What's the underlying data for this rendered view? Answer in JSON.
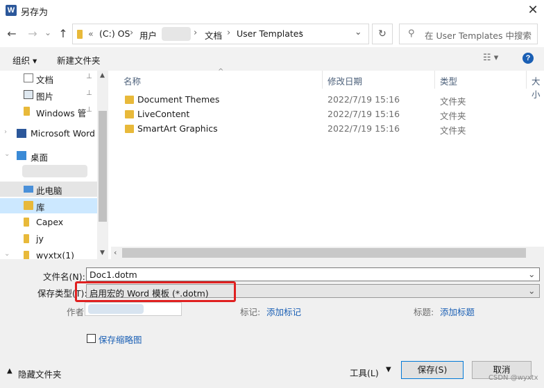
{
  "window": {
    "title": "另存为",
    "app_icon": "W",
    "close": "✕"
  },
  "nav": {
    "back": "←",
    "forward": "→",
    "dropdown": "⌄",
    "up": "↑",
    "refresh": "↻"
  },
  "address": {
    "overflow": "«",
    "segments": [
      "(C:) OS",
      "用户",
      "文档",
      "User Templates"
    ],
    "sep": "›",
    "dropdown": "⌄"
  },
  "search": {
    "placeholder": "在 User Templates 中搜索"
  },
  "toolbar": {
    "organize": "组织 ▾",
    "new_folder": "新建文件夹",
    "view": "☷ ▾",
    "help": "?"
  },
  "navpane": {
    "items": [
      {
        "label": "文档",
        "pinned": true
      },
      {
        "label": "图片",
        "pinned": true
      },
      {
        "label": "Windows 管理",
        "pinned": true
      },
      {
        "label": "Microsoft Word",
        "pinned": false
      },
      {
        "label": "桌面",
        "pinned": false
      },
      {
        "label": "此电脑",
        "pinned": false
      },
      {
        "label": "库",
        "pinned": false
      },
      {
        "label": "Capex",
        "pinned": false
      },
      {
        "label": "jy",
        "pinned": false
      },
      {
        "label": "wyxtx(1)",
        "pinned": false
      }
    ],
    "pin_glyph": "📌"
  },
  "list": {
    "columns": [
      "名称",
      "修改日期",
      "类型",
      "大小"
    ],
    "rows": [
      {
        "name": "Document Themes",
        "date": "2022/7/19 15:16",
        "type": "文件夹"
      },
      {
        "name": "LiveContent",
        "date": "2022/7/19 15:16",
        "type": "文件夹"
      },
      {
        "name": "SmartArt Graphics",
        "date": "2022/7/19 15:16",
        "type": "文件夹"
      }
    ]
  },
  "form": {
    "filename_label": "文件名(N):",
    "filename_value": "Doc1.dotm",
    "filetype_label": "保存类型(T):",
    "filetype_value": "启用宏的 Word 模板 (*.dotm)",
    "author_label": "作者:",
    "tags_label": "标记:",
    "tags_link": "添加标记",
    "title_label": "标题:",
    "title_link": "添加标题",
    "thumbnail_label": "保存缩略图",
    "hide_folders": "隐藏文件夹",
    "tools": "工具(L)",
    "save": "保存(S)",
    "cancel": "取消"
  },
  "watermark": "CSDN @wyxtx",
  "colors": {
    "accent": "#0078d7",
    "highlight_box": "#e02020",
    "folder": "#e8b93a",
    "link": "#1a5fb4"
  }
}
